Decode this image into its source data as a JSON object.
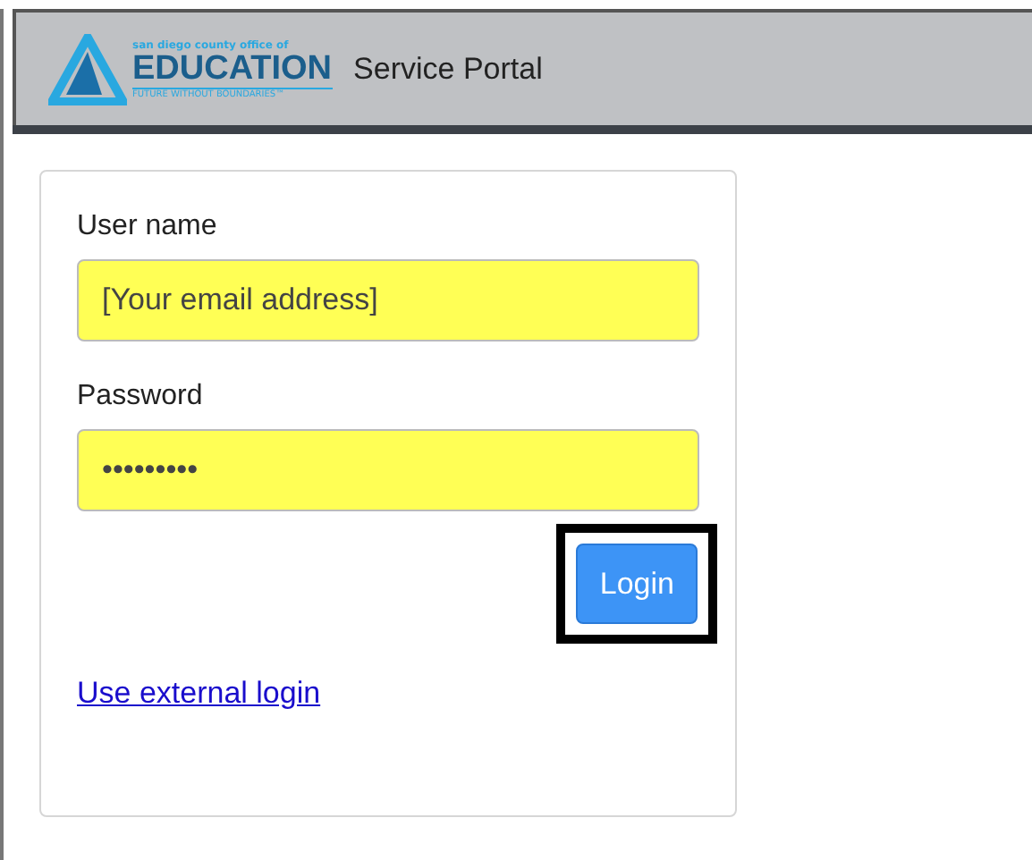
{
  "header": {
    "logo": {
      "top_line": "san diego county office of",
      "name": "EDUCATION",
      "tagline": "FUTURE WITHOUT BOUNDARIES™"
    },
    "title": "Service Portal"
  },
  "login_form": {
    "fields": [
      {
        "label": "User name",
        "value": "[Your email address]"
      },
      {
        "label": "Password",
        "value": "•••••••••"
      }
    ],
    "login_button": {
      "label": "Login",
      "highlighted": true
    },
    "external_link": "Use external login"
  }
}
